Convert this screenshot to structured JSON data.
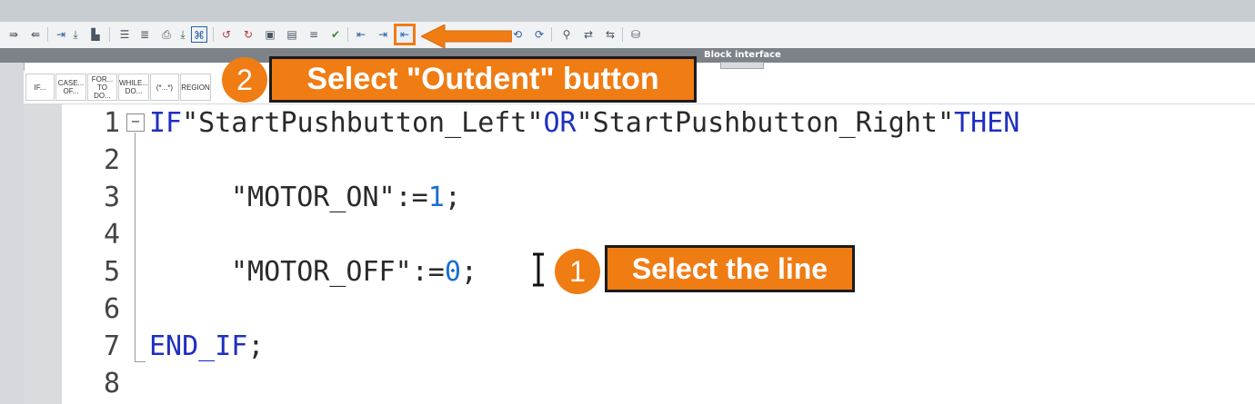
{
  "toolbar": {
    "icons": [
      "indent-lines-icon",
      "outdent-lines-icon",
      "insert-arrow-icon",
      "download-icon",
      "network-icon",
      "list-icon",
      "list-edit-icon",
      "print-preview-icon",
      "download-small-icon",
      "snippet-icon",
      "comment-remove-icon",
      "comment-delete-icon",
      "monitor-icon",
      "monitor-alt-icon",
      "align-icon",
      "checkmark-icon",
      "indent-icon",
      "indent-alt-icon",
      "outdent-icon",
      "wrap-icon",
      "block-icon",
      "goto-icon",
      "goto-back-icon",
      "find-icon",
      "replace-icon",
      "compare-icon",
      "database-icon"
    ]
  },
  "block_interface": {
    "title": "Block interface"
  },
  "snippets": [
    {
      "label": "IF..."
    },
    {
      "label": "CASE...\nOF..."
    },
    {
      "label": "FOR...\nTO DO..."
    },
    {
      "label": "WHILE...\nDO..."
    },
    {
      "label": "(*...*)"
    },
    {
      "label": "REGION"
    }
  ],
  "callouts": {
    "step2_number": "2",
    "step2_text": "Select \"Outdent\" button",
    "step1_number": "1",
    "step1_text": "Select the line"
  },
  "code": {
    "line_numbers": [
      "1",
      "2",
      "3",
      "4",
      "5",
      "6",
      "7",
      "8"
    ],
    "line1": {
      "kw1": "IF",
      "tag1": "\"StartPushbutton_Left\"",
      "kw2": "OR",
      "tag2": "\"StartPushbutton_Right\"",
      "kw3": "THEN"
    },
    "line3": {
      "tag": "\"MOTOR_ON\"",
      "assign": ":=",
      "value": "1",
      "end": ";"
    },
    "line5": {
      "tag": "\"MOTOR_OFF\"",
      "assign": ":=",
      "value": "0",
      "end": ";"
    },
    "line7": {
      "kw": "END_IF",
      "end": ";"
    }
  },
  "colors": {
    "accent": "#f07c14",
    "keyword": "#1f2fc0",
    "number": "#1a6fcf"
  }
}
